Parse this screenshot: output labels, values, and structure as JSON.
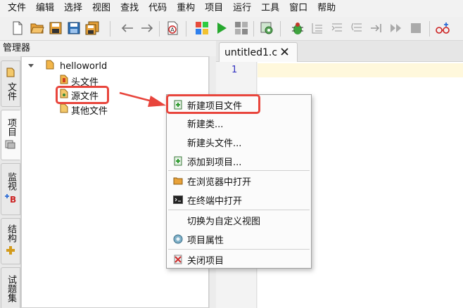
{
  "menubar": {
    "items": [
      "文件",
      "编辑",
      "选择",
      "视图",
      "查找",
      "代码",
      "重构",
      "项目",
      "运行",
      "工具",
      "窗口",
      "帮助"
    ]
  },
  "toolbar": {
    "icons": [
      "new-file-icon",
      "open-folder-icon",
      "save-icon",
      "save-as-icon",
      "save-all-icon",
      "back-arrow-icon",
      "forward-arrow-icon",
      "format-code-icon",
      "windows-logo-icon",
      "run-icon",
      "layout-icon",
      "settings-icon",
      "debug-bug-icon",
      "step-icon",
      "step-into-icon",
      "step-out-icon",
      "run-to-cursor-icon",
      "continue-icon",
      "stop-icon",
      "breakpoint-icon"
    ]
  },
  "manager": {
    "title": "管理器",
    "tabs": [
      {
        "label": "文件",
        "icon": "file-icon"
      },
      {
        "label": "项目",
        "icon": "project-icon"
      },
      {
        "label": "监视",
        "icon": "watch-icon"
      },
      {
        "label": "结构",
        "icon": "structure-icon"
      },
      {
        "label": "试题集",
        "icon": "problem-set-icon"
      }
    ],
    "tree": {
      "root": "helloworld",
      "children": [
        "头文件",
        "源文件",
        "其他文件"
      ]
    }
  },
  "editor": {
    "tab_title": "untitled1.c",
    "line_numbers": [
      "1"
    ]
  },
  "context_menu": {
    "items": [
      {
        "label": "新建项目文件",
        "icon": "add-file-icon"
      },
      {
        "label": "新建类...",
        "icon": ""
      },
      {
        "label": "新建头文件...",
        "icon": ""
      },
      {
        "label": "添加到项目...",
        "icon": "add-to-project-icon"
      },
      {
        "label": "在浏览器中打开",
        "icon": "folder-open-icon"
      },
      {
        "label": "在终端中打开",
        "icon": "terminal-icon"
      },
      {
        "label": "切换为自定义视图",
        "icon": ""
      },
      {
        "label": "项目属性",
        "icon": "properties-icon"
      },
      {
        "label": "关闭项目",
        "icon": "close-project-icon"
      }
    ]
  },
  "colors": {
    "highlight": "#e8453c",
    "current_line": "#fff8dc",
    "line_number": "#3030c0"
  }
}
